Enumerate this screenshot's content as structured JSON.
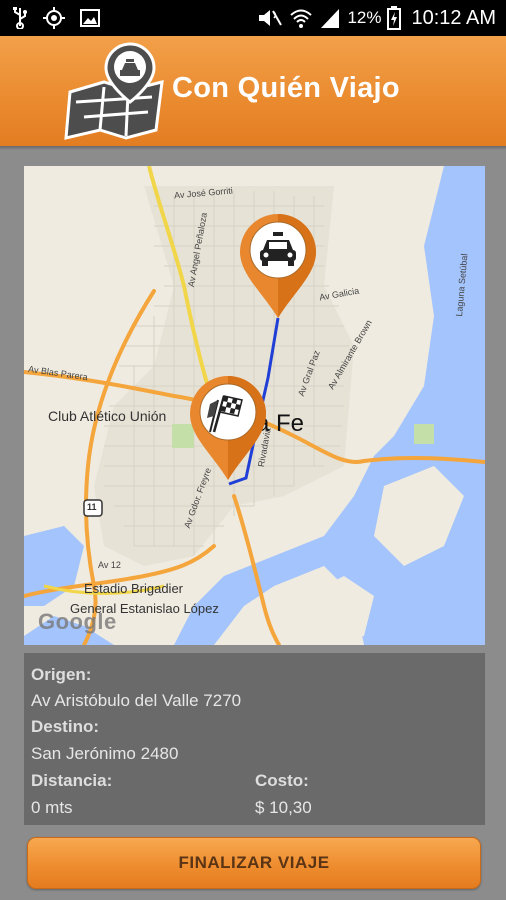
{
  "status_bar": {
    "icons": [
      "usb-icon",
      "gps-icon",
      "image-icon",
      "mute-icon",
      "wifi-icon",
      "signal-icon",
      "battery-icon"
    ],
    "battery": "12%",
    "time": "10:12 AM"
  },
  "app_header": {
    "title": "Con Quién Viajo",
    "logo_icon": "taxi-map-logo-icon"
  },
  "map": {
    "labels": {
      "union": "Club Atlético Unión",
      "city": "a Fe",
      "stadium_1": "Estadio Brigadier",
      "stadium_2": "General Estanislao López",
      "google": "Google",
      "route_11": "11"
    },
    "street_labels": {
      "gorriti": "Av José Gorriti",
      "penaloza": "Av Angel Peñaloza",
      "galicia": "Av Galicia",
      "blas_parera": "Av Blas Parera",
      "gral_paz": "Av Gral Paz",
      "almirante_brown": "Av Almirante Brown",
      "laguna_setubal": "Laguna Setúbal",
      "freyre": "Av Gdor. Freyre",
      "rivadavia": "Rivadavia",
      "av_12": "Av 12"
    },
    "origin_pin_icon": "taxi-icon",
    "destination_pin_icon": "checkered-flag-icon",
    "route_color": "#1f3fd6",
    "accent_color": "#e8872d"
  },
  "trip": {
    "origin_label": "Origen:",
    "origin_value": "Av Aristóbulo del Valle 7270",
    "destination_label": "Destino:",
    "destination_value": "San Jerónimo 2480",
    "distance_label": "Distancia:",
    "distance_value": "0 mts",
    "cost_label": "Costo:",
    "cost_value": "$ 10,30"
  },
  "actions": {
    "finish_label": "FINALIZAR VIAJE"
  }
}
